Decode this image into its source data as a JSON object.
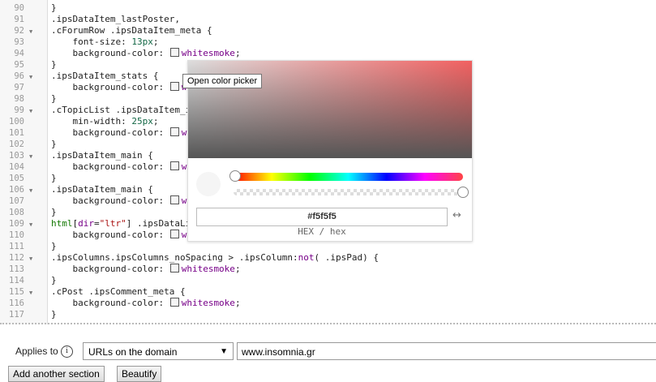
{
  "editor": {
    "lines": [
      {
        "num": "90",
        "fold": false,
        "html": "}"
      },
      {
        "num": "91",
        "fold": false,
        "html": ".ipsDataItem_lastPoster,"
      },
      {
        "num": "92",
        "fold": true,
        "html": ".cForumRow .ipsDataItem_meta {"
      },
      {
        "num": "93",
        "fold": false,
        "html": "    font-size: <span class='num'>13px</span>;"
      },
      {
        "num": "94",
        "fold": false,
        "html": "    background-color: <span class='sw'></span><span class='kw'>whitesmoke</span>;"
      },
      {
        "num": "95",
        "fold": false,
        "html": "}"
      },
      {
        "num": "96",
        "fold": true,
        "html": ".ipsDataItem_stats {"
      },
      {
        "num": "97",
        "fold": false,
        "html": "    background-color: <span class='sw'></span><span class='kw'>whitesmoke</span>;"
      },
      {
        "num": "98",
        "fold": false,
        "html": "}"
      },
      {
        "num": "99",
        "fold": true,
        "html": ".cTopicList .ipsDataItem_icon {"
      },
      {
        "num": "100",
        "fold": false,
        "html": "    min-width: <span class='num'>25px</span>;"
      },
      {
        "num": "101",
        "fold": false,
        "html": "    background-color: <span class='sw'></span><span class='kw'>whitesmoke</span>;"
      },
      {
        "num": "102",
        "fold": false,
        "html": "}"
      },
      {
        "num": "103",
        "fold": true,
        "html": ".ipsDataItem_main {"
      },
      {
        "num": "104",
        "fold": false,
        "html": "    background-color: <span class='sw'></span><span class='kw'>whitesmoke</span>;"
      },
      {
        "num": "105",
        "fold": false,
        "html": "}"
      },
      {
        "num": "106",
        "fold": true,
        "html": ".ipsDataItem_main {"
      },
      {
        "num": "107",
        "fold": false,
        "html": "    background-color: <span class='sw'></span><span class='kw'>whitesmoke</span>;"
      },
      {
        "num": "108",
        "fold": false,
        "html": "}"
      },
      {
        "num": "109",
        "fold": true,
        "html": "<span class='tag'>html</span>[<span class='kw'>dir</span>=<span class='str'>\"ltr\"</span>] .ipsDataList_large .ipsDataItem_icon {"
      },
      {
        "num": "110",
        "fold": false,
        "html": "    background-color: <span class='sw'></span><span class='kw'>whitesmoke</span>;"
      },
      {
        "num": "111",
        "fold": false,
        "html": "}"
      },
      {
        "num": "112",
        "fold": true,
        "html": ".ipsColumns.ipsColumns_noSpacing &gt; .ipsColumn:<span class='kw'>not</span>( .ipsPad) {"
      },
      {
        "num": "113",
        "fold": false,
        "html": "    background-color: <span class='sw'></span><span class='kw'>whitesmoke</span>;"
      },
      {
        "num": "114",
        "fold": false,
        "html": "}"
      },
      {
        "num": "115",
        "fold": true,
        "html": ".cPost .ipsComment_meta {"
      },
      {
        "num": "116",
        "fold": false,
        "html": "    background-color: <span class='sw'></span><span class='kw'>whitesmoke</span>;"
      },
      {
        "num": "117",
        "fold": false,
        "html": "}"
      }
    ]
  },
  "tooltip": {
    "text": "Open color picker"
  },
  "picker": {
    "hex_value": "#f5f5f5",
    "modes_label": "HEX / hex",
    "swap_icon": "↔",
    "color": "#f5f5f5"
  },
  "bottom": {
    "applies_label": "Applies to",
    "info_icon": "i",
    "select_value": "URLs on the domain",
    "select_arrow": "▼",
    "domain_value": "www.insomnia.gr",
    "add_section_label": "Add another section",
    "beautify_label": "Beautify"
  }
}
